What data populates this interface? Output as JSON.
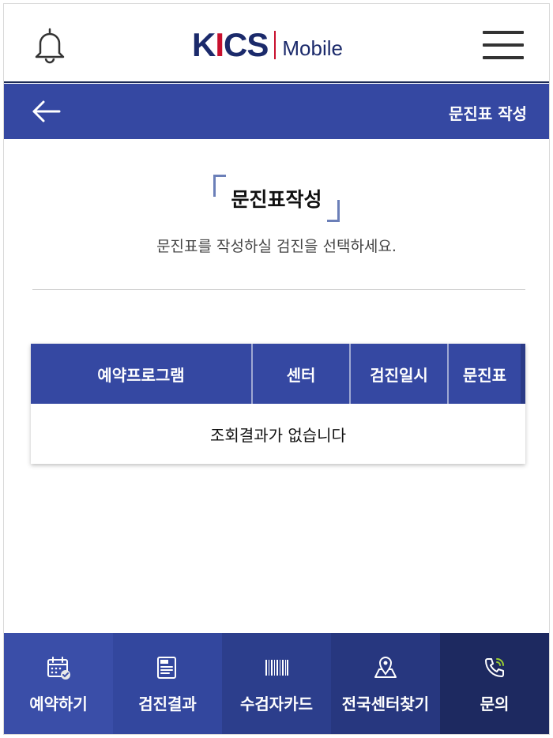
{
  "header": {
    "logo_kics_k": "K",
    "logo_kics_i": "I",
    "logo_kics_cs": "CS",
    "logo_mobile": "Mobile",
    "bell_icon": "bell-icon",
    "menu_icon": "hamburger-menu-icon"
  },
  "subbar": {
    "back_icon": "arrow-left-icon",
    "title": "문진표 작성"
  },
  "main": {
    "title": "문진표작성",
    "subtitle": "문진표를 작성하실 검진을 선택하세요."
  },
  "table": {
    "columns": [
      "예약프로그램",
      "센터",
      "검진일시",
      "문진표"
    ],
    "empty_message": "조회결과가 없습니다"
  },
  "bottom_nav": {
    "items": [
      {
        "label": "예약하기",
        "icon": "calendar-check-icon"
      },
      {
        "label": "검진결과",
        "icon": "document-icon"
      },
      {
        "label": "수검자카드",
        "icon": "barcode-icon"
      },
      {
        "label": "전국센터찾기",
        "icon": "map-pin-icon"
      },
      {
        "label": "문의",
        "icon": "phone-call-icon"
      }
    ]
  },
  "colors": {
    "primary": "#3548a2",
    "brand_navy": "#1b2a6b",
    "brand_red": "#c8102e"
  }
}
